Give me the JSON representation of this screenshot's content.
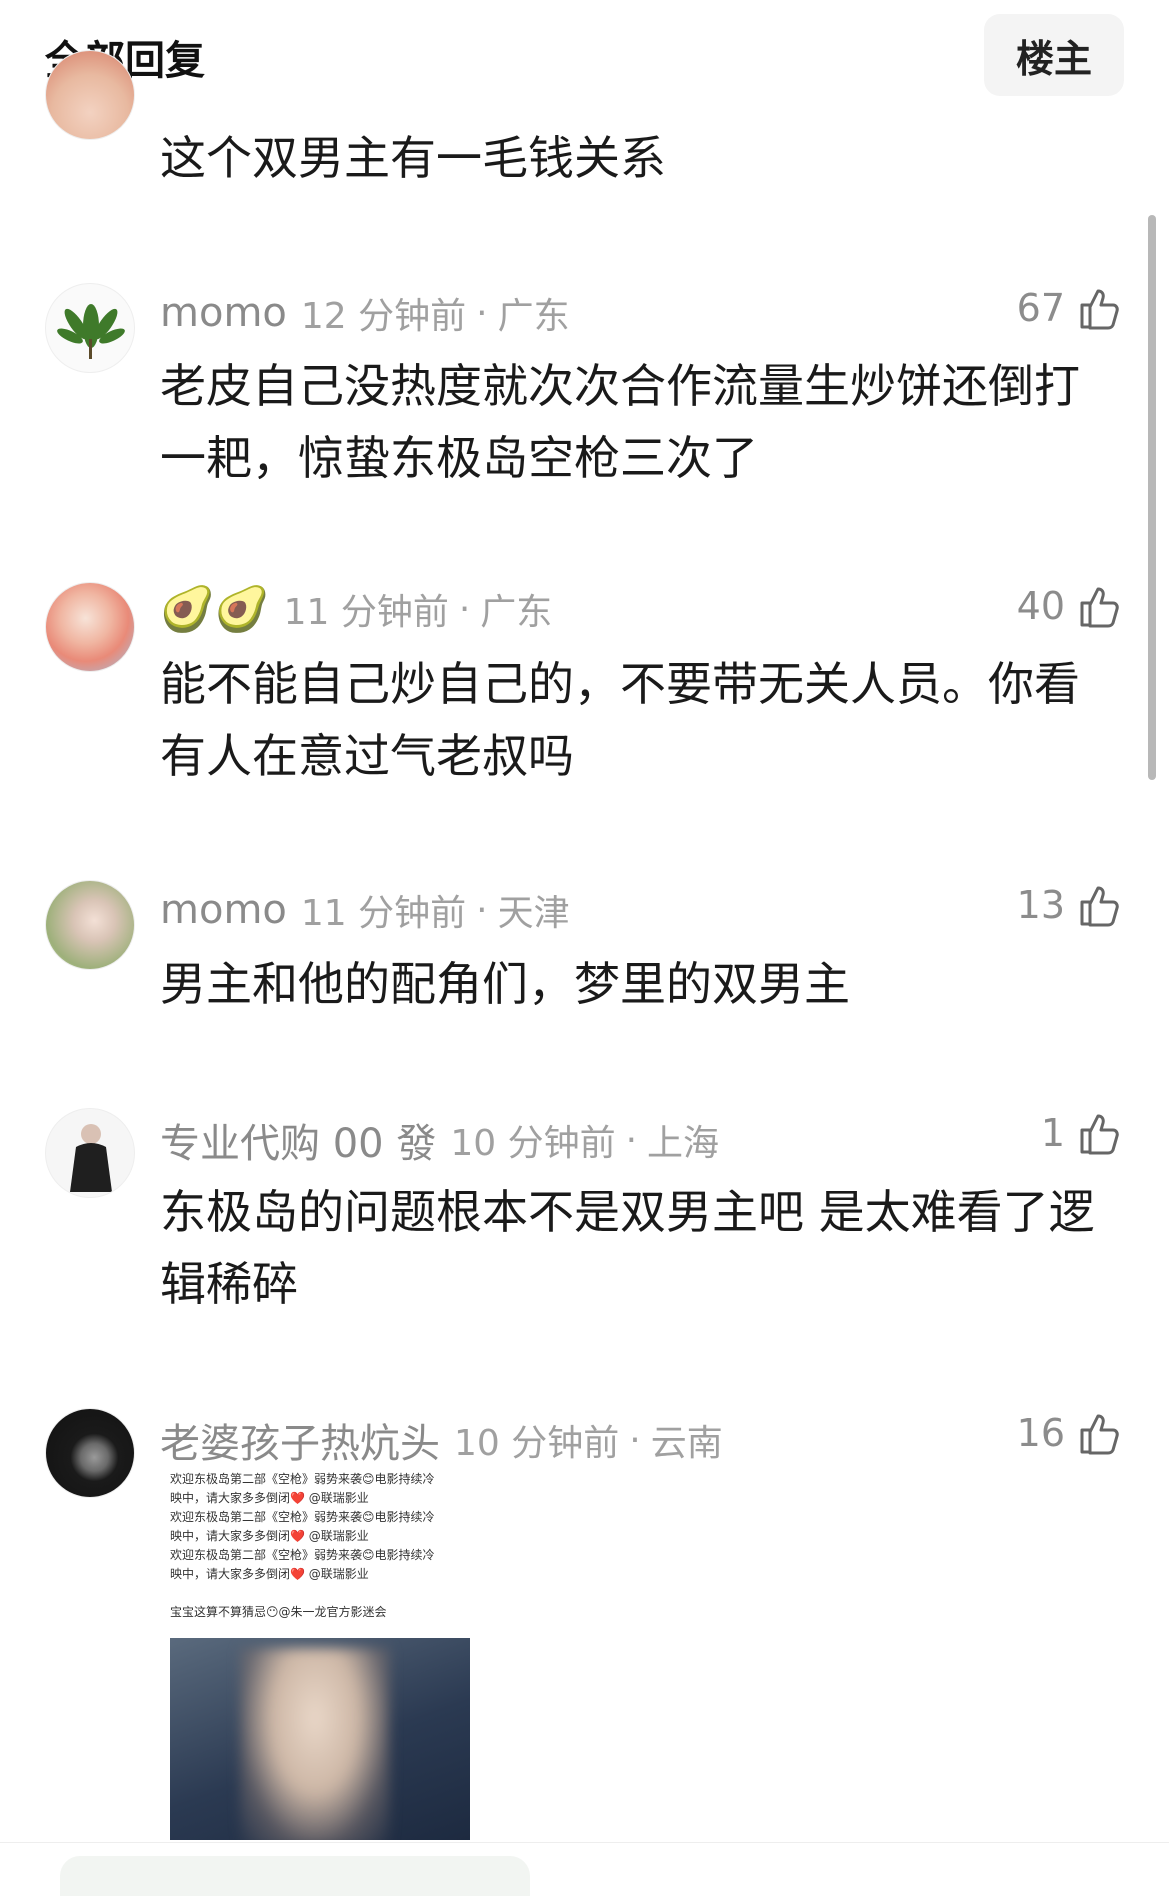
{
  "header": {
    "title": "全部回复",
    "owner_button": "楼主"
  },
  "comments": [
    {
      "text": "这个双男主有一毛钱关系"
    },
    {
      "name": "momo",
      "time": "12 分钟前",
      "location": "广东",
      "likes": "67",
      "text": "老皮自己没热度就次次合作流量生炒饼还倒打一耙，惊蛰东极岛空枪三次了"
    },
    {
      "name": "🥑🥑",
      "time": "11 分钟前",
      "location": "广东",
      "likes": "40",
      "text": "能不能自己炒自己的，不要带无关人员。你看有人在意过气老叔吗"
    },
    {
      "name": "momo",
      "time": "11 分钟前",
      "location": "天津",
      "likes": "13",
      "text": "男主和他的配角们，梦里的双男主"
    },
    {
      "name": "专业代购 00 發",
      "time": "10 分钟前",
      "location": "上海",
      "likes": "1",
      "text": "东极岛的问题根本不是双男主吧 是太难看了逻辑稀碎"
    },
    {
      "name": "老婆孩子热炕头",
      "time": "10 分钟前",
      "location": "云南",
      "likes": "16",
      "image_lines": [
        "欢迎东极岛第二部《空枪》弱势来袭😊电影持续冷",
        "映中，请大家多多倒闭❤️ @联瑞影业",
        "欢迎东极岛第二部《空枪》弱势来袭😊电影持续冷",
        "映中，请大家多多倒闭❤️ @联瑞影业",
        "欢迎东极岛第二部《空枪》弱势来袭😊电影持续冷",
        "映中，请大家多多倒闭❤️ @联瑞影业",
        "",
        "宝宝这算不算猜忌😶@朱一龙官方影迷会"
      ]
    }
  ],
  "separator": "·",
  "icons": {
    "like": "thumbs-up-icon"
  },
  "colors": {
    "meta": "#8c8c8c",
    "text": "#1a1a1a",
    "button_bg": "#f4f4f4"
  }
}
